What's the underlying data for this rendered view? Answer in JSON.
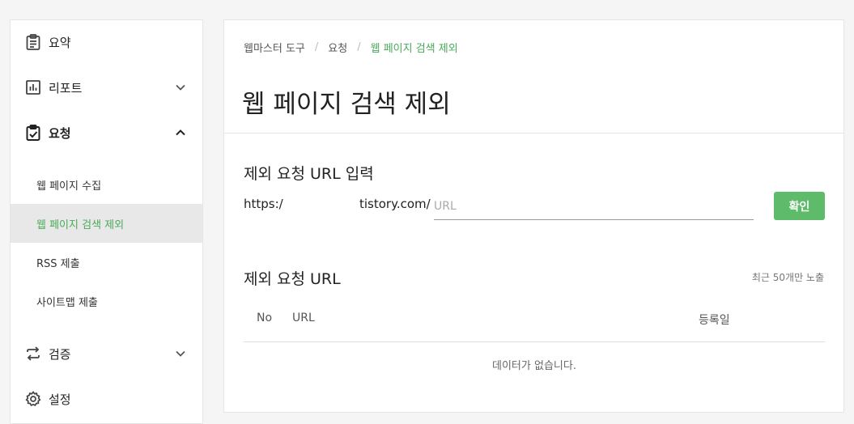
{
  "sidebar": {
    "items": [
      {
        "label": "요약",
        "icon": "clipboard-icon"
      },
      {
        "label": "리포트",
        "icon": "bar-chart-icon"
      },
      {
        "label": "요청",
        "icon": "clipboard-check-icon"
      },
      {
        "label": "검증",
        "icon": "repeat-icon"
      },
      {
        "label": "설정",
        "icon": "gear-icon"
      }
    ],
    "sub_items": [
      {
        "label": "웹 페이지 수집"
      },
      {
        "label": "웹 페이지 검색 제외",
        "active": true
      },
      {
        "label": "RSS 제출"
      },
      {
        "label": "사이트맵 제출"
      }
    ]
  },
  "breadcrumb": {
    "items": [
      "웹마스터 도구",
      "요청",
      "웹 페이지 검색 제외"
    ],
    "separator": "/"
  },
  "page": {
    "title": "웹 페이지 검색 제외"
  },
  "form": {
    "title": "제외 요청 URL 입력",
    "url_prefix": "https:/",
    "url_suffix": "tistory.com/",
    "placeholder": "URL",
    "value": "",
    "confirm_label": "확인"
  },
  "list": {
    "title": "제외 요청 URL",
    "note": "최근 50개만 노출",
    "columns": [
      "No",
      "URL",
      "등록일"
    ],
    "empty_message": "데이터가 없습니다."
  },
  "colors": {
    "accent": "#5dbb6a",
    "active_text": "#4aaa5a"
  }
}
